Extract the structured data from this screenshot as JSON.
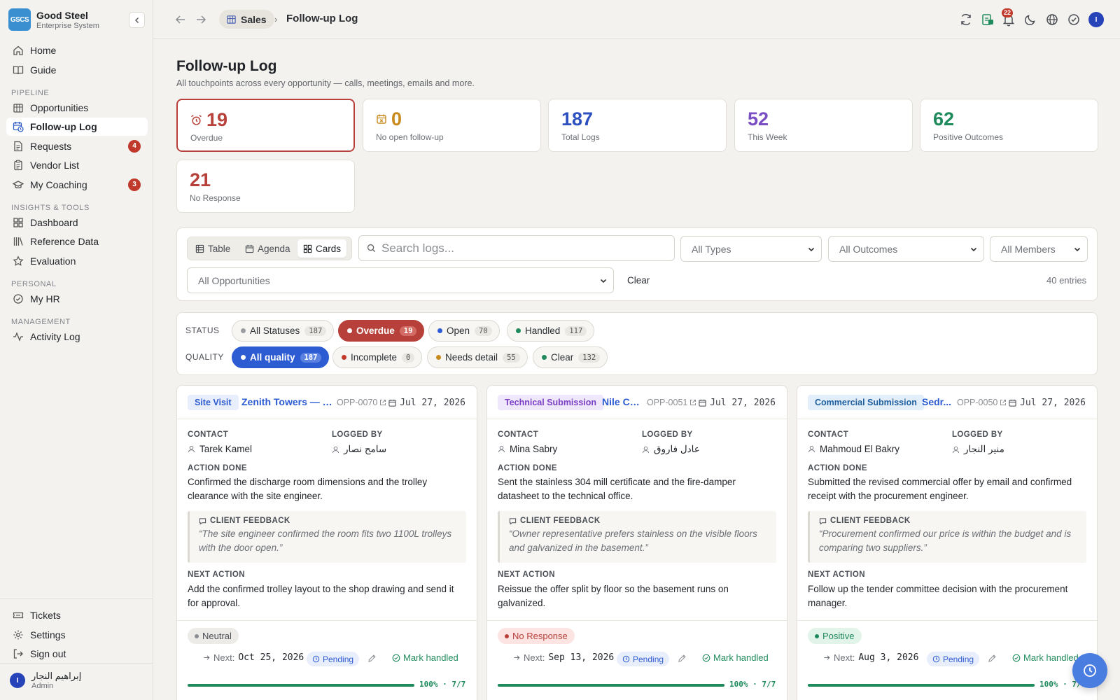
{
  "brand": {
    "logo": "GSCS",
    "name": "Good Steel",
    "subtitle": "Enterprise System"
  },
  "sidebar": {
    "top": [
      {
        "label": "Home",
        "icon": "home-icon"
      },
      {
        "label": "Guide",
        "icon": "book-icon"
      }
    ],
    "pipeline_label": "PIPELINE",
    "pipeline": [
      {
        "label": "Opportunities",
        "icon": "building-icon"
      },
      {
        "label": "Follow-up Log",
        "icon": "calendar-clock-icon",
        "active": true
      },
      {
        "label": "Requests",
        "icon": "document-icon",
        "badge": "4"
      },
      {
        "label": "Vendor List",
        "icon": "clipboard-icon"
      },
      {
        "label": "My Coaching",
        "icon": "graduation-icon",
        "badge": "3"
      }
    ],
    "insights_label": "INSIGHTS & TOOLS",
    "insights": [
      {
        "label": "Dashboard",
        "icon": "grid-icon"
      },
      {
        "label": "Reference Data",
        "icon": "library-icon"
      },
      {
        "label": "Evaluation",
        "icon": "star-icon"
      }
    ],
    "personal_label": "PERSONAL",
    "personal": [
      {
        "label": "My HR",
        "icon": "check-circle-icon"
      }
    ],
    "management_label": "MANAGEMENT",
    "management": [
      {
        "label": "Activity Log",
        "icon": "activity-icon"
      }
    ],
    "bottom": [
      {
        "label": "Tickets",
        "icon": "ticket-icon"
      },
      {
        "label": "Settings",
        "icon": "gear-icon"
      },
      {
        "label": "Sign out",
        "icon": "sign-out-icon"
      }
    ],
    "user": {
      "initial": "I",
      "name": "إبراهيم النجار",
      "role": "Admin"
    }
  },
  "topbar": {
    "crumb_parent": "Sales",
    "crumb_sep": "›",
    "crumb_current": "Follow-up Log",
    "notif_count": "22",
    "avatar": "I"
  },
  "page": {
    "title": "Follow-up Log",
    "subtitle": "All touchpoints across every opportunity — calls, meetings, emails and more."
  },
  "stats": [
    {
      "value": "19",
      "label": "Overdue",
      "color": "#b7413a",
      "icon": "alarm-icon"
    },
    {
      "value": "0",
      "label": "No open follow-up",
      "color": "#c98a1e",
      "icon": "calendar-x-icon"
    },
    {
      "value": "187",
      "label": "Total Logs",
      "color": "#2d4fbf"
    },
    {
      "value": "52",
      "label": "This Week",
      "color": "#7b4fc4"
    },
    {
      "value": "62",
      "label": "Positive Outcomes",
      "color": "#1f8a5b"
    },
    {
      "value": "21",
      "label": "No Response",
      "color": "#b7413a"
    }
  ],
  "filters": {
    "views": [
      "Table",
      "Agenda",
      "Cards"
    ],
    "search_placeholder": "Search logs...",
    "type": "All Types",
    "outcome": "All Outcomes",
    "member": "All Members",
    "opportunity": "All Opportunities",
    "clear": "Clear",
    "entries": "40 entries"
  },
  "status_row": {
    "label": "STATUS",
    "chips": [
      {
        "label": "All Statuses",
        "count": "187",
        "dot": "#9a9da2"
      },
      {
        "label": "Overdue",
        "count": "19",
        "dot": "#ffffff"
      },
      {
        "label": "Open",
        "count": "70",
        "dot": "#2d5bd2"
      },
      {
        "label": "Handled",
        "count": "117",
        "dot": "#1f8a5b"
      }
    ]
  },
  "quality_row": {
    "label": "QUALITY",
    "chips": [
      {
        "label": "All quality",
        "count": "187",
        "dot": "#ffffff"
      },
      {
        "label": "Incomplete",
        "count": "0",
        "dot": "#c0392b"
      },
      {
        "label": "Needs detail",
        "count": "55",
        "dot": "#c98a1e"
      },
      {
        "label": "Clear",
        "count": "132",
        "dot": "#1f8a5b"
      }
    ]
  },
  "card_labels": {
    "contact": "CONTACT",
    "logged_by": "LOGGED BY",
    "action_done": "ACTION DONE",
    "client_feedback": "CLIENT FEEDBACK",
    "next_action": "NEXT ACTION",
    "next": "Next:",
    "pending": "Pending",
    "mark_handled": "Mark handled"
  },
  "cards": [
    {
      "type": "Site Visit",
      "type_bg": "#e8eefb",
      "type_color": "#2d5bd2",
      "opportunity": "Zenith Towers — He...",
      "code": "OPP-0070",
      "date": "Jul 27, 2026",
      "contact": "Tarek Kamel",
      "logged_by": "سامح نصار",
      "action": "Confirmed the discharge room dimensions and the trolley clearance with the site engineer.",
      "feedback": "“The site engineer confirmed the room fits two 1100L trolleys with the door open.”",
      "next_action": "Add the confirmed trolley layout to the shop drawing and send it for approval.",
      "outcome": "Neutral",
      "outcome_bg": "#ecebe7",
      "outcome_color": "#4a4e55",
      "outcome_dot": "#8a8d92",
      "next_date": "Oct 25, 2026",
      "progress_pct": 100,
      "progress_text": "100% · 7/7"
    },
    {
      "type": "Technical Submission",
      "type_bg": "#efe7fb",
      "type_color": "#7b3fc4",
      "opportunity": "Nile Co...",
      "code": "OPP-0051",
      "date": "Jul 27, 2026",
      "contact": "Mina Sabry",
      "logged_by": "عادل فاروق",
      "action": "Sent the stainless 304 mill certificate and the fire-damper datasheet to the technical office.",
      "feedback": "“Owner representative prefers stainless on the visible floors and galvanized in the basement.”",
      "next_action": "Reissue the offer split by floor so the basement runs on galvanized.",
      "outcome": "No Response",
      "outcome_bg": "#fbe4e2",
      "outcome_color": "#b7413a",
      "outcome_dot": "#b7413a",
      "next_date": "Sep 13, 2026",
      "progress_pct": 100,
      "progress_text": "100% · 7/7"
    },
    {
      "type": "Commercial Submission",
      "type_bg": "#e3eefb",
      "type_color": "#1f5f9e",
      "opportunity": "Sedr...",
      "code": "OPP-0050",
      "date": "Jul 27, 2026",
      "contact": "Mahmoud El Bakry",
      "logged_by": "منير النجار",
      "action": "Submitted the revised commercial offer by email and confirmed receipt with the procurement engineer.",
      "feedback": "“Procurement confirmed our price is within the budget and is comparing two suppliers.”",
      "next_action": "Follow up the tender committee decision with the procurement manager.",
      "outcome": "Positive",
      "outcome_bg": "#e2f3ea",
      "outcome_color": "#1f8a5b",
      "outcome_dot": "#1f8a5b",
      "next_date": "Aug 3, 2026",
      "progress_pct": 100,
      "progress_text": "100% · 7/7"
    }
  ]
}
